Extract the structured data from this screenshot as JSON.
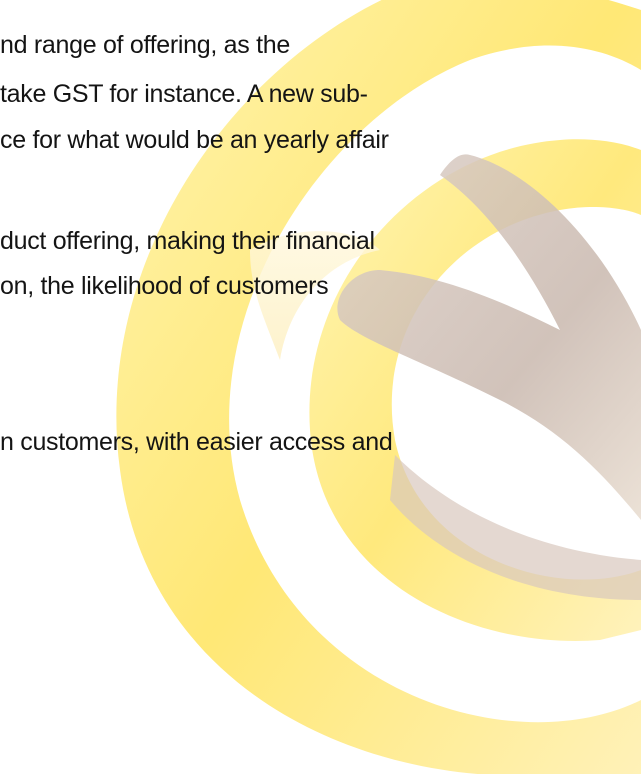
{
  "document": {
    "lines": [
      "nd range of offering, as the",
      "take GST for instance. A new sub-",
      "ce for what would be an yearly affair",
      "duct offering, making their financial",
      "on, the likelihood of customers",
      "n customers, with easier access and"
    ]
  },
  "colors": {
    "text": "#141414",
    "swirl_yellow": "#ffe566",
    "swirl_cream": "#fdf1c4",
    "swirl_mauve": "#cdbab0"
  }
}
